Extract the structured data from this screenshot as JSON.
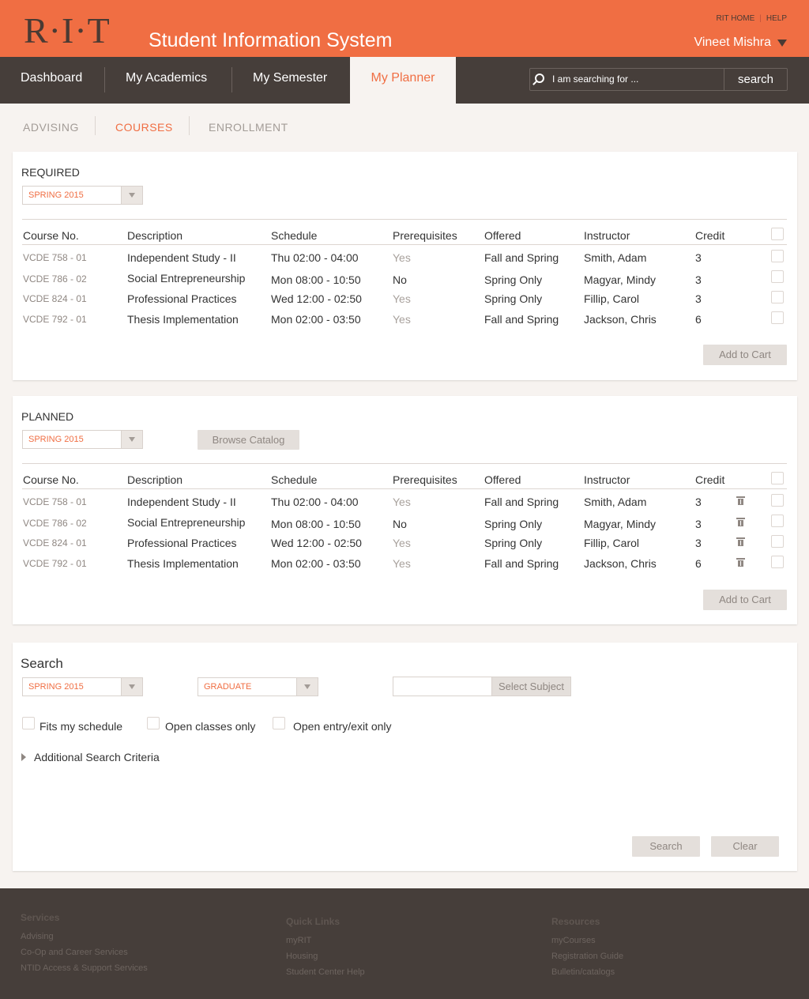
{
  "header": {
    "logo": "R·I·T",
    "title": "Student Information System",
    "top_links": [
      "RIT HOME",
      "HELP"
    ],
    "user_name": "Vineet Mishra"
  },
  "nav": {
    "items": [
      "Dashboard",
      "My Academics",
      "My Semester",
      "My Planner"
    ],
    "active": "My Planner",
    "search_placeholder": "I am searching for ...",
    "search_button": "search"
  },
  "subtabs": {
    "items": [
      "ADVISING",
      "COURSES",
      "ENROLLMENT"
    ],
    "active": "COURSES"
  },
  "columns": [
    "Course No.",
    "Description",
    "Schedule",
    "Prerequisites",
    "Offered",
    "Instructor",
    "Credit"
  ],
  "required": {
    "title": "REQUIRED",
    "term": "SPRING 2015",
    "rows": [
      {
        "code": "VCDE 758 - 01",
        "description": "Independent Study - II",
        "schedule": "Thu 02:00 - 04:00",
        "prereq": "Yes",
        "offered": "Fall and Spring",
        "instructor": "Smith, Adam",
        "credit": "3"
      },
      {
        "code": "VCDE 786 - 02",
        "description": "Social Entrepreneurship",
        "schedule": "Mon 08:00 - 10:50",
        "prereq": "No",
        "offered": "Spring Only",
        "instructor": "Magyar, Mindy",
        "credit": "3"
      },
      {
        "code": "VCDE 824 - 01",
        "description": "Professional Practices",
        "schedule": "Wed 12:00 - 02:50",
        "prereq": "Yes",
        "offered": "Spring Only",
        "instructor": "Fillip, Carol",
        "credit": "3"
      },
      {
        "code": "VCDE 792 - 01",
        "description": "Thesis Implementation",
        "schedule": "Mon 02:00 - 03:50",
        "prereq": "Yes",
        "offered": "Fall and Spring",
        "instructor": "Jackson, Chris",
        "credit": "6"
      }
    ],
    "add_to_cart": "Add to Cart"
  },
  "planned": {
    "title": "PLANNED",
    "term": "SPRING 2015",
    "browse_catalog": "Browse Catalog",
    "rows": [
      {
        "code": "VCDE 758 - 01",
        "description": "Independent Study - II",
        "schedule": "Thu 02:00 - 04:00",
        "prereq": "Yes",
        "offered": "Fall and Spring",
        "instructor": "Smith, Adam",
        "credit": "3"
      },
      {
        "code": "VCDE 786 - 02",
        "description": "Social Entrepreneurship",
        "schedule": "Mon 08:00 - 10:50",
        "prereq": "No",
        "offered": "Spring Only",
        "instructor": "Magyar, Mindy",
        "credit": "3"
      },
      {
        "code": "VCDE 824 - 01",
        "description": "Professional Practices",
        "schedule": "Wed 12:00 - 02:50",
        "prereq": "Yes",
        "offered": "Spring Only",
        "instructor": "Fillip, Carol",
        "credit": "3"
      },
      {
        "code": "VCDE 792 - 01",
        "description": "Thesis Implementation",
        "schedule": "Mon 02:00 - 03:50",
        "prereq": "Yes",
        "offered": "Fall and Spring",
        "instructor": "Jackson, Chris",
        "credit": "6"
      }
    ],
    "add_to_cart": "Add to Cart"
  },
  "search": {
    "title": "Search",
    "term": "SPRING 2015",
    "level": "GRADUATE",
    "select_subject": "Select Subject",
    "options": [
      "Fits my schedule",
      "Open classes only",
      "Open entry/exit only"
    ],
    "additional": "Additional Search Criteria",
    "search_button": "Search",
    "clear_button": "Clear"
  },
  "footer": {
    "columns": [
      {
        "heading": "Services",
        "links": [
          "Advising",
          "Co-Op and Career Services",
          "NTID Access & Support Services"
        ]
      },
      {
        "heading": "Quick Links",
        "links": [
          "myRIT",
          "Housing",
          "Student Center Help"
        ]
      },
      {
        "heading": "Resources",
        "links": [
          "myCourses",
          "Registration Guide",
          "Bulletin/catalogs"
        ]
      }
    ]
  },
  "colors": {
    "brand": "#f06e43",
    "dark": "#463e3a",
    "background": "#f7f3f0"
  }
}
